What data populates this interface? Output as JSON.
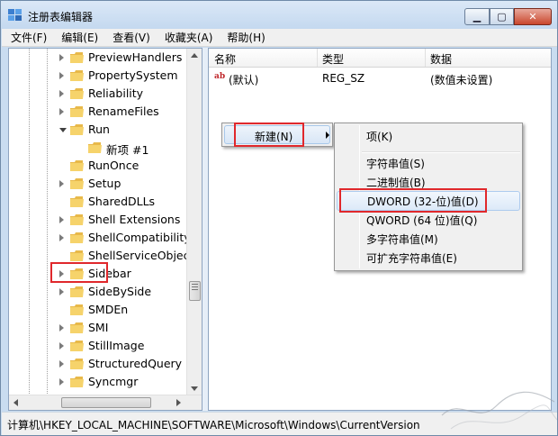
{
  "window": {
    "title": "注册表编辑器",
    "controls": {
      "minimize": "▁",
      "maximize": "▢",
      "close": "✕"
    }
  },
  "menubar": {
    "items": [
      "文件(F)",
      "编辑(E)",
      "查看(V)",
      "收藏夹(A)",
      "帮助(H)"
    ]
  },
  "tree": {
    "items": [
      {
        "label": "PreviewHandlers",
        "expandable": true
      },
      {
        "label": "PropertySystem",
        "expandable": true
      },
      {
        "label": "Reliability",
        "expandable": true
      },
      {
        "label": "RenameFiles",
        "expandable": true
      },
      {
        "label": "Run",
        "expandable": true,
        "expanded": true
      },
      {
        "label": "新项 #1",
        "expandable": false,
        "child": true
      },
      {
        "label": "RunOnce",
        "expandable": false
      },
      {
        "label": "Setup",
        "expandable": true
      },
      {
        "label": "SharedDLLs",
        "expandable": false
      },
      {
        "label": "Shell Extensions",
        "expandable": true
      },
      {
        "label": "ShellCompatibility",
        "expandable": true
      },
      {
        "label": "ShellServiceObjectDelayLoad",
        "expandable": false
      },
      {
        "label": "Sidebar",
        "expandable": true,
        "highlighted": true
      },
      {
        "label": "SideBySide",
        "expandable": true
      },
      {
        "label": "SMDEn",
        "expandable": false
      },
      {
        "label": "SMI",
        "expandable": true
      },
      {
        "label": "StillImage",
        "expandable": true
      },
      {
        "label": "StructuredQuery",
        "expandable": true
      },
      {
        "label": "Syncmgr",
        "expandable": true
      }
    ]
  },
  "values": {
    "columns": {
      "name": "名称",
      "type": "类型",
      "data": "数据"
    },
    "rows": [
      {
        "icon": "ab",
        "name": "(默认)",
        "type": "REG_SZ",
        "data": "(数值未设置)"
      }
    ]
  },
  "context_menu": {
    "new_item": "新建(N)",
    "submenu": {
      "key": "项(K)",
      "items": [
        "字符串值(S)",
        "二进制值(B)",
        "DWORD (32-位)值(D)",
        "QWORD (64 位)值(Q)",
        "多字符串值(M)",
        "可扩充字符串值(E)"
      ],
      "highlighted_index": 2
    }
  },
  "statusbar": {
    "path": "计算机\\HKEY_LOCAL_MACHINE\\SOFTWARE\\Microsoft\\Windows\\CurrentVersion"
  },
  "colors": {
    "annotation_red": "#e0282c",
    "folder_yellow": "#f2c94c",
    "title_bg": "#c9dcf0"
  }
}
